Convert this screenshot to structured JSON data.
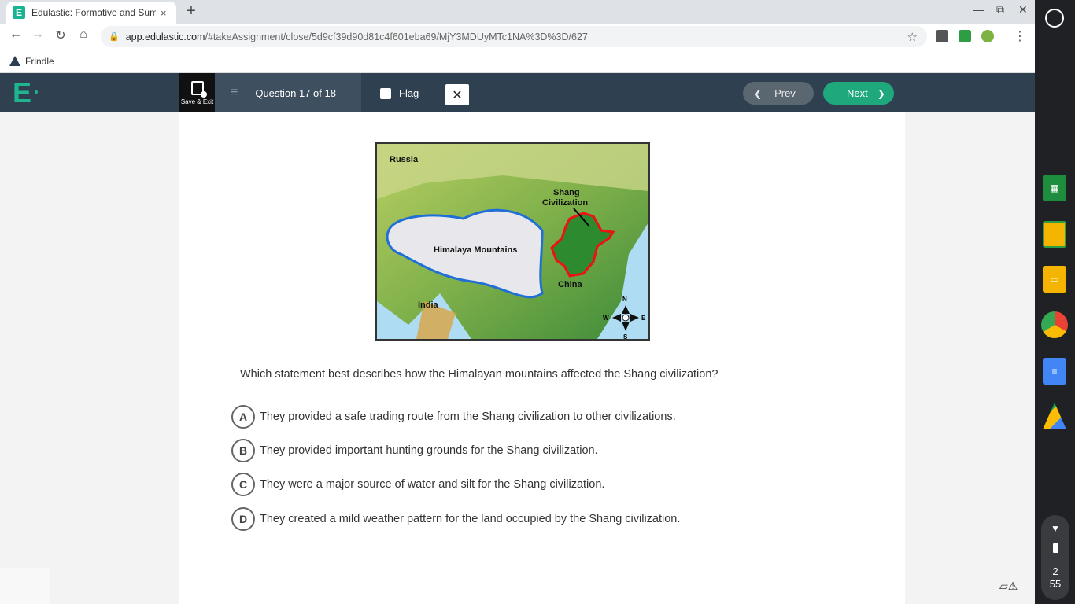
{
  "browser": {
    "tab_title": "Edulastic: Formative and Summ",
    "tab_close": "×",
    "new_tab": "+",
    "url_host": "app.edulastic.com",
    "url_path": "/#takeAssignment/close/5d9cf39d90d81c4f601eba69/MjY3MDUyMTc1NA%3D%3D/627",
    "bookmark_label": "Frindle"
  },
  "header": {
    "logo": "E",
    "save_exit_label": "Save & Exit",
    "question_counter": "Question 17 of 18",
    "flag_label": "Flag",
    "close_label": "✕",
    "prev_label": "Prev",
    "next_label": "Next"
  },
  "map": {
    "labels": {
      "russia": "Russia",
      "shang_line1": "Shang",
      "shang_line2": "Civilization",
      "himalaya": "Himalaya Mountains",
      "china": "China",
      "india": "India",
      "n": "N",
      "s": "S",
      "e": "E",
      "w": "W"
    }
  },
  "question": {
    "text": "Which statement best describes how the Himalayan mountains affected the Shang civilization?",
    "options": [
      {
        "letter": "A",
        "text": "They provided a safe trading route from the Shang civilization to other civilizations."
      },
      {
        "letter": "B",
        "text": "They provided important hunting grounds for the Shang civilization."
      },
      {
        "letter": "C",
        "text": "They were a major source of water and silt for the Shang civilization."
      },
      {
        "letter": "D",
        "text": "They created a mild weather pattern for the land occupied by the Shang civilization."
      }
    ]
  },
  "shelf": {
    "clock_hour": "2",
    "clock_min": "55"
  },
  "colors": {
    "brand_green": "#1fb58f",
    "header_bg": "#2f4151",
    "next_green": "#1fa87c"
  }
}
